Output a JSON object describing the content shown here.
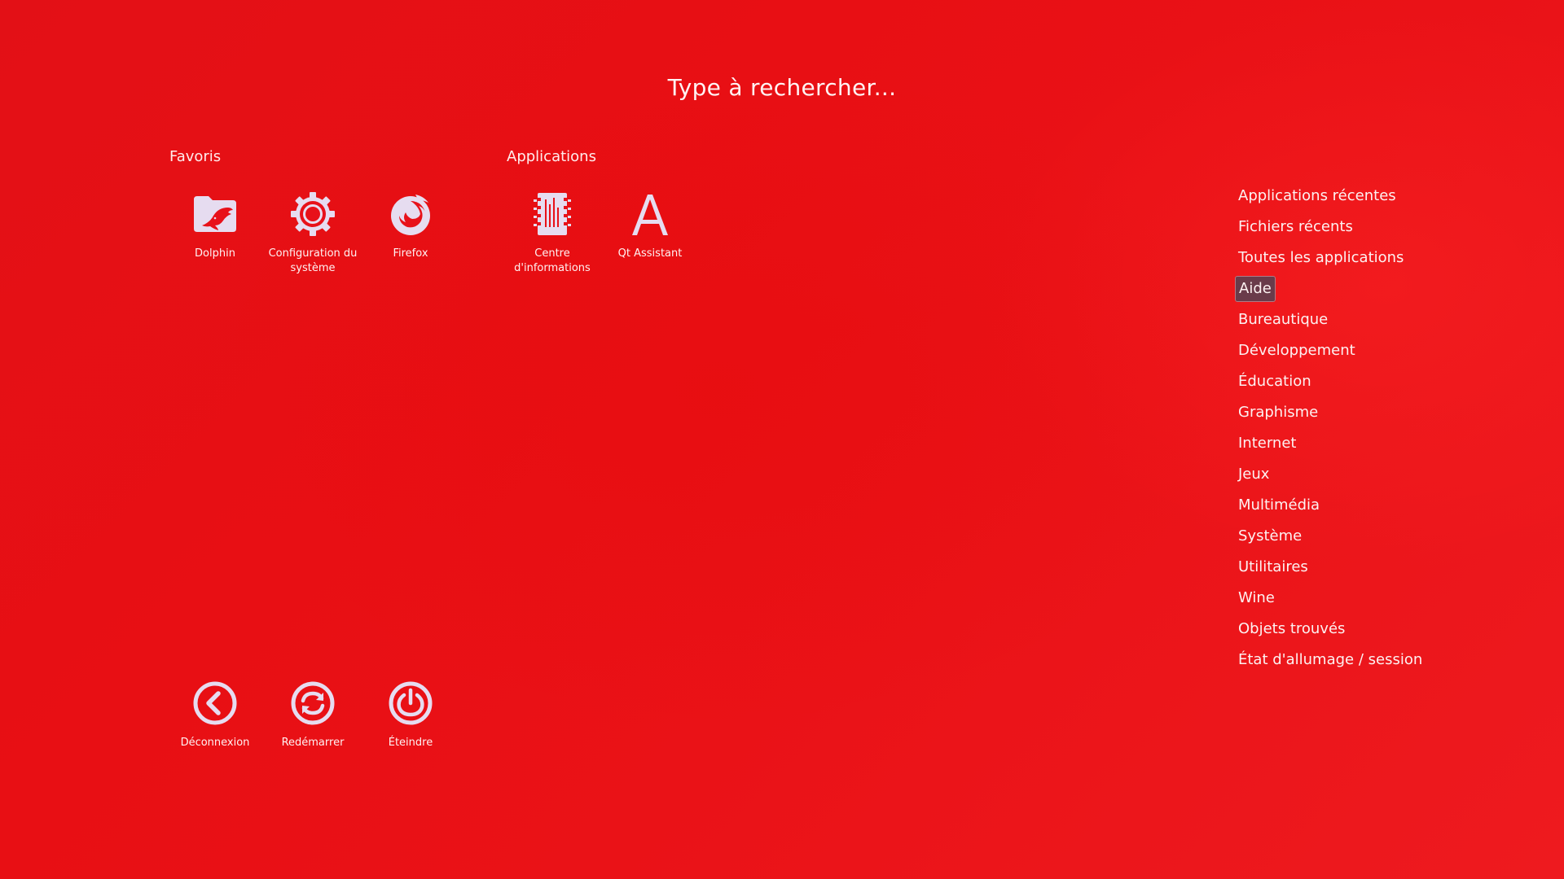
{
  "search": {
    "placeholder": "Type à rechercher..."
  },
  "favorites": {
    "title": "Favoris",
    "items": [
      {
        "label": "Dolphin",
        "icon": "dolphin-folder-icon"
      },
      {
        "label": "Configuration du système",
        "icon": "gear-icon"
      },
      {
        "label": "Firefox",
        "icon": "firefox-icon"
      }
    ]
  },
  "applications": {
    "title": "Applications",
    "items": [
      {
        "label": "Centre d'informations",
        "icon": "info-center-icon"
      },
      {
        "label": "Qt Assistant",
        "icon": "qt-assistant-icon"
      }
    ]
  },
  "session": {
    "items": [
      {
        "label": "Déconnexion",
        "icon": "logout-icon"
      },
      {
        "label": "Redémarrer",
        "icon": "restart-icon"
      },
      {
        "label": "Éteindre",
        "icon": "power-icon"
      }
    ]
  },
  "categories": {
    "selected": "Aide",
    "items": [
      "Applications récentes",
      "Fichiers récents",
      "Toutes les applications",
      "Aide",
      "Bureautique",
      "Développement",
      "Éducation",
      "Graphisme",
      "Internet",
      "Jeux",
      "Multimédia",
      "Système",
      "Utilitaires",
      "Wine",
      "Objets trouvés",
      "État d'allumage / session"
    ]
  },
  "colors": {
    "background": "#e8111a",
    "icon": "#e6dcf0",
    "selection": "#6a3b4a"
  }
}
